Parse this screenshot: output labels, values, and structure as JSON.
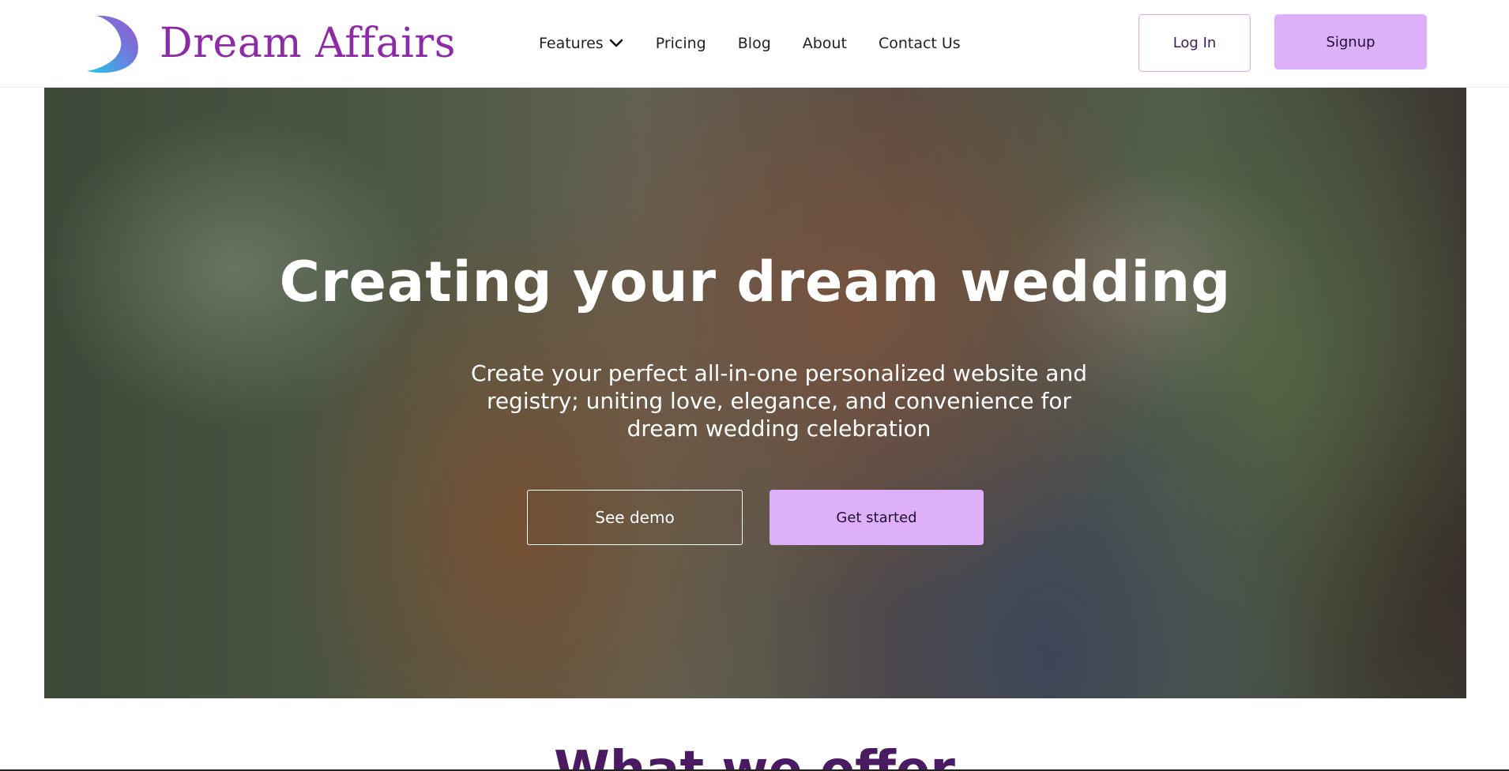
{
  "brand": {
    "name": "Dream Affairs",
    "logo_icon": "crescent-moon-icon",
    "color": "#8d2aa6"
  },
  "nav": {
    "items": [
      {
        "label": "Features",
        "has_dropdown": true
      },
      {
        "label": "Pricing"
      },
      {
        "label": "Blog"
      },
      {
        "label": "About"
      },
      {
        "label": "Contact Us"
      }
    ]
  },
  "auth": {
    "login_label": "Log In",
    "signup_label": "Signup"
  },
  "hero": {
    "title": "Creating your dream wedding",
    "subtitle": "Create your perfect all-in-one personalized website and registry; uniting love, elegance, and convenience for dream wedding celebration",
    "demo_label": "See demo",
    "start_label": "Get started"
  },
  "section": {
    "title": "What we offer"
  },
  "colors": {
    "accent": "#dfb0fa",
    "heading": "#4a1b63"
  }
}
